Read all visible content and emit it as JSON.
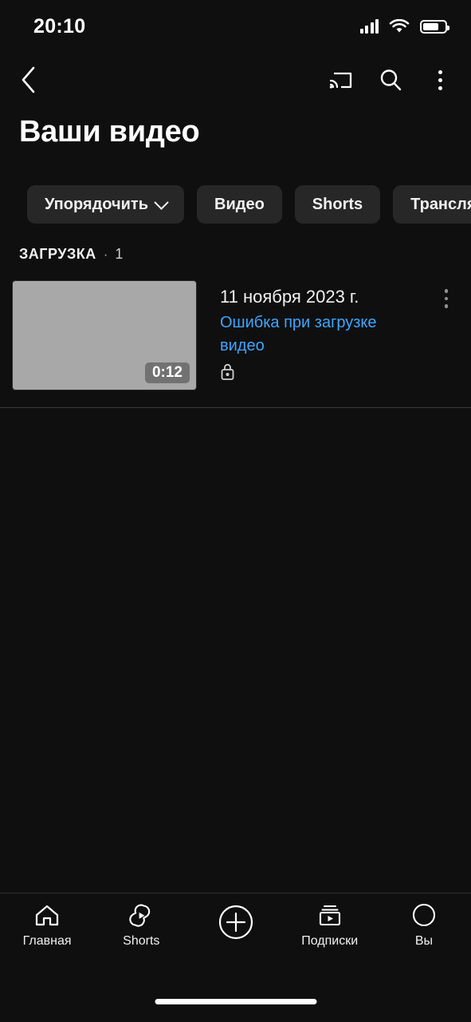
{
  "status_bar": {
    "time": "20:10",
    "signal_icon": "cellular-signal-icon",
    "wifi_icon": "wifi-icon",
    "battery_icon": "battery-icon",
    "battery_level": "74%"
  },
  "app_bar": {
    "back_icon": "back-chevron-icon",
    "cast_icon": "cast-icon",
    "search_icon": "search-icon",
    "overflow_icon": "more-vertical-icon"
  },
  "header": {
    "title": "Ваши видео"
  },
  "chips": [
    {
      "label": "Упорядочить",
      "has_chevron": true,
      "icon": "chevron-down-icon"
    },
    {
      "label": "Видео",
      "has_chevron": false
    },
    {
      "label": "Shorts",
      "has_chevron": false
    },
    {
      "label": "Трансляции",
      "has_chevron": false
    }
  ],
  "section": {
    "label": "ЗАГРУЗКА",
    "separator": "·",
    "count": "1"
  },
  "video": {
    "duration": "0:12",
    "date": "11 ноября 2023 г.",
    "error": "Ошибка при загрузке видео",
    "privacy_icon": "lock-icon",
    "menu_icon": "more-vertical-icon",
    "thumbnail_color": "#a8a8a8"
  },
  "colors": {
    "background": "#0f0f0f",
    "chip_background": "#272727",
    "link_blue": "#3ea6ff",
    "text_primary": "#f1f1f1",
    "divider": "#3a3a3a"
  },
  "bottom_nav": [
    {
      "label": "Главная",
      "icon": "home-icon"
    },
    {
      "label": "Shorts",
      "icon": "shorts-icon"
    },
    {
      "label": "",
      "icon": "create-plus-icon"
    },
    {
      "label": "Подписки",
      "icon": "subscriptions-icon"
    },
    {
      "label": "Вы",
      "icon": "account-avatar-icon"
    }
  ]
}
